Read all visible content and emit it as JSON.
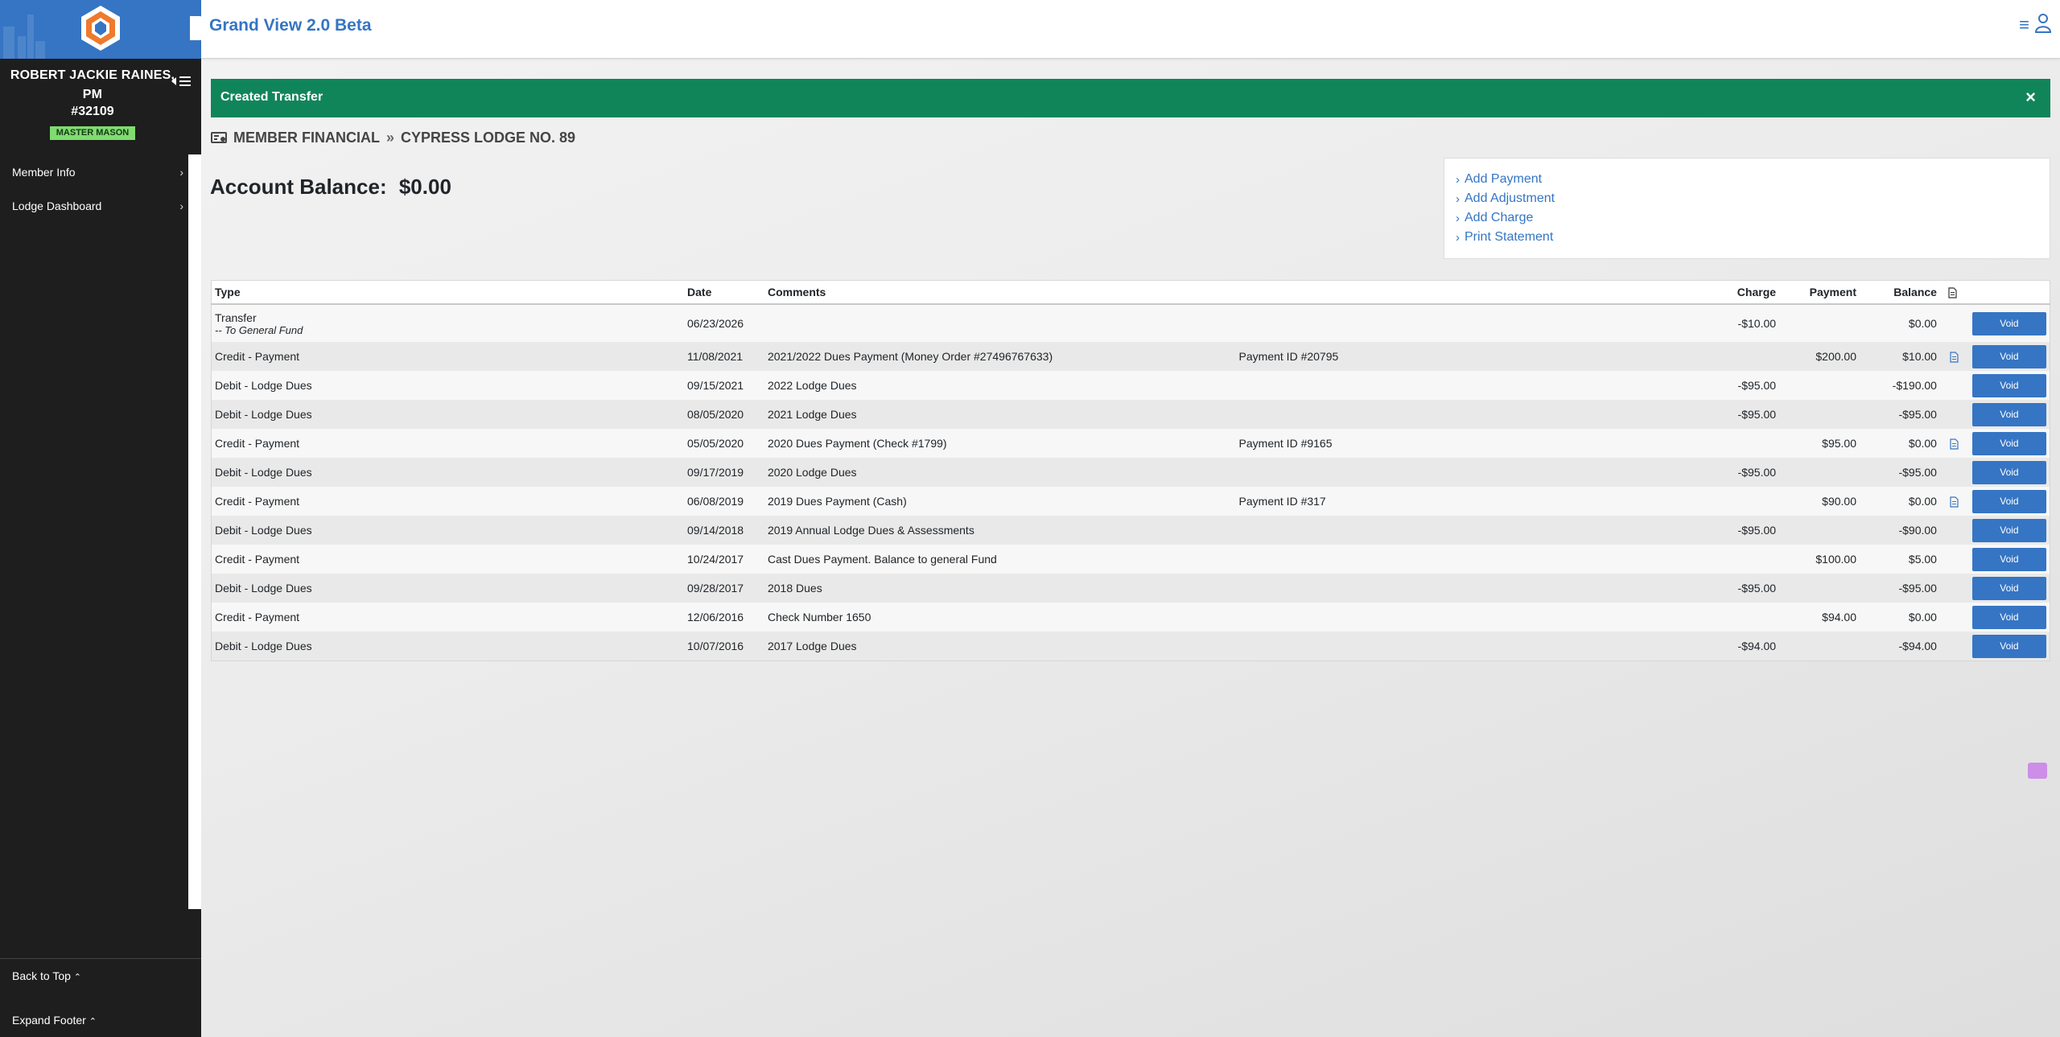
{
  "app": {
    "title": "Grand View 2.0 Beta"
  },
  "member": {
    "name": "ROBERT JACKIE RAINES, PM",
    "number": "#32109",
    "degree": "MASTER MASON"
  },
  "sidebar": {
    "items": [
      {
        "label": "Member Info",
        "icon": "chevron-right-icon"
      },
      {
        "label": "Lodge Dashboard",
        "icon": "chevron-right-icon"
      }
    ],
    "back_to_top": "Back to Top",
    "expand_footer": "Expand Footer"
  },
  "alert": {
    "message": "Created Transfer",
    "close": "×",
    "color": "#11855a"
  },
  "breadcrumb": {
    "section": "MEMBER FINANCIAL",
    "lodge": "CYPRESS LODGE NO. 89"
  },
  "balance": {
    "label": "Account Balance:",
    "value": "$0.00"
  },
  "actions": [
    "Add Payment",
    "Add Adjustment",
    "Add Charge",
    "Print Statement"
  ],
  "table": {
    "headers": {
      "type": "Type",
      "date": "Date",
      "comments": "Comments",
      "charge": "Charge",
      "payment": "Payment",
      "balance": "Balance"
    },
    "rows": [
      {
        "type": "Transfer",
        "sub": "-- To General Fund",
        "date": "06/23/2026",
        "comment": "",
        "ref": "",
        "charge": "-$10.00",
        "payment": "",
        "balance": "$0.00",
        "doc": false,
        "action": "Void"
      },
      {
        "type": "Credit - Payment",
        "sub": "",
        "date": "11/08/2021",
        "comment": "2021/2022 Dues Payment (Money Order #27496767633)",
        "ref": "Payment ID #20795",
        "charge": "",
        "payment": "$200.00",
        "balance": "$10.00",
        "doc": true,
        "action": "Void"
      },
      {
        "type": "Debit - Lodge Dues",
        "sub": "",
        "date": "09/15/2021",
        "comment": "2022 Lodge Dues",
        "ref": "",
        "charge": "-$95.00",
        "payment": "",
        "balance": "-$190.00",
        "doc": false,
        "action": "Void"
      },
      {
        "type": "Debit - Lodge Dues",
        "sub": "",
        "date": "08/05/2020",
        "comment": "2021 Lodge Dues",
        "ref": "",
        "charge": "-$95.00",
        "payment": "",
        "balance": "-$95.00",
        "doc": false,
        "action": "Void"
      },
      {
        "type": "Credit - Payment",
        "sub": "",
        "date": "05/05/2020",
        "comment": "2020 Dues Payment (Check #1799)",
        "ref": "Payment ID #9165",
        "charge": "",
        "payment": "$95.00",
        "balance": "$0.00",
        "doc": true,
        "action": "Void"
      },
      {
        "type": "Debit - Lodge Dues",
        "sub": "",
        "date": "09/17/2019",
        "comment": "2020 Lodge Dues",
        "ref": "",
        "charge": "-$95.00",
        "payment": "",
        "balance": "-$95.00",
        "doc": false,
        "action": "Void"
      },
      {
        "type": "Credit - Payment",
        "sub": "",
        "date": "06/08/2019",
        "comment": "2019 Dues Payment (Cash)",
        "ref": "Payment ID #317",
        "charge": "",
        "payment": "$90.00",
        "balance": "$0.00",
        "doc": true,
        "action": "Void"
      },
      {
        "type": "Debit - Lodge Dues",
        "sub": "",
        "date": "09/14/2018",
        "comment": "2019 Annual Lodge Dues & Assessments",
        "ref": "",
        "charge": "-$95.00",
        "payment": "",
        "balance": "-$90.00",
        "doc": false,
        "action": "Void"
      },
      {
        "type": "Credit - Payment",
        "sub": "",
        "date": "10/24/2017",
        "comment": "Cast Dues Payment. Balance to general Fund",
        "ref": "",
        "charge": "",
        "payment": "$100.00",
        "balance": "$5.00",
        "doc": false,
        "action": "Void"
      },
      {
        "type": "Debit - Lodge Dues",
        "sub": "",
        "date": "09/28/2017",
        "comment": "2018 Dues",
        "ref": "",
        "charge": "-$95.00",
        "payment": "",
        "balance": "-$95.00",
        "doc": false,
        "action": "Void"
      },
      {
        "type": "Credit - Payment",
        "sub": "",
        "date": "12/06/2016",
        "comment": "Check Number 1650",
        "ref": "",
        "charge": "",
        "payment": "$94.00",
        "balance": "$0.00",
        "doc": false,
        "action": "Void"
      },
      {
        "type": "Debit - Lodge Dues",
        "sub": "",
        "date": "10/07/2016",
        "comment": "2017 Lodge Dues",
        "ref": "",
        "charge": "-$94.00",
        "payment": "",
        "balance": "-$94.00",
        "doc": false,
        "action": "Void"
      }
    ]
  },
  "colors": {
    "brand": "#3575c4",
    "sidebar": "#1e1e1e",
    "success": "#11855a",
    "badge": "#7fdc6f"
  }
}
